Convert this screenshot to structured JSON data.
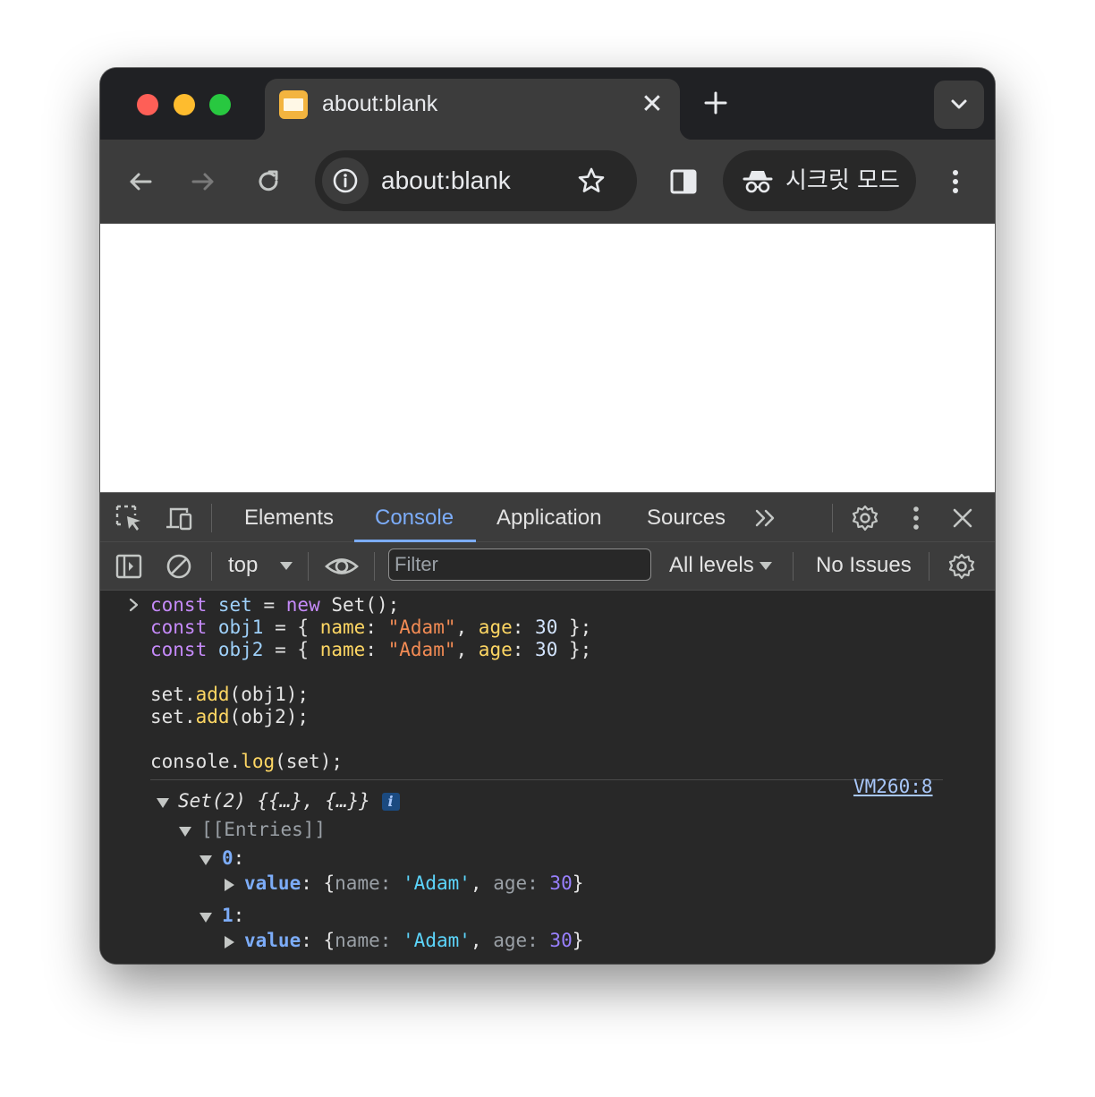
{
  "tab": {
    "title": "about:blank",
    "close_glyph": "✕"
  },
  "toolbar": {
    "url": "about:blank",
    "incognito_label": "시크릿 모드"
  },
  "devtools": {
    "tabs": [
      "Elements",
      "Console",
      "Application",
      "Sources"
    ],
    "active_tab": "Console",
    "context": "top",
    "filter_placeholder": "Filter",
    "levels": "All levels",
    "issues": "No Issues"
  },
  "console": {
    "input_lines": [
      "const set = new Set();",
      "const obj1 = { name: \"Adam\", age: 30 };",
      "const obj2 = { name: \"Adam\", age: 30 };",
      "",
      "set.add(obj1);",
      "set.add(obj2);",
      "",
      "console.log(set);"
    ],
    "output": {
      "summary": "Set(2) {{…}, {…}}",
      "info_badge": "i",
      "source_link": "VM260:8",
      "entries_label": "[[Entries]]",
      "entries": [
        {
          "index": "0",
          "value_key": "value",
          "name_key": "name",
          "name_value": "'Adam'",
          "age_key": "age",
          "age_value": "30"
        },
        {
          "index": "1",
          "value_key": "value",
          "name_key": "name",
          "name_value": "'Adam'",
          "age_key": "age",
          "age_value": "30"
        }
      ]
    }
  },
  "colors": {
    "active_tab": "#7cacf8",
    "keyword": "#c58af9",
    "string": "#f28b54",
    "property": "#fdd663"
  }
}
